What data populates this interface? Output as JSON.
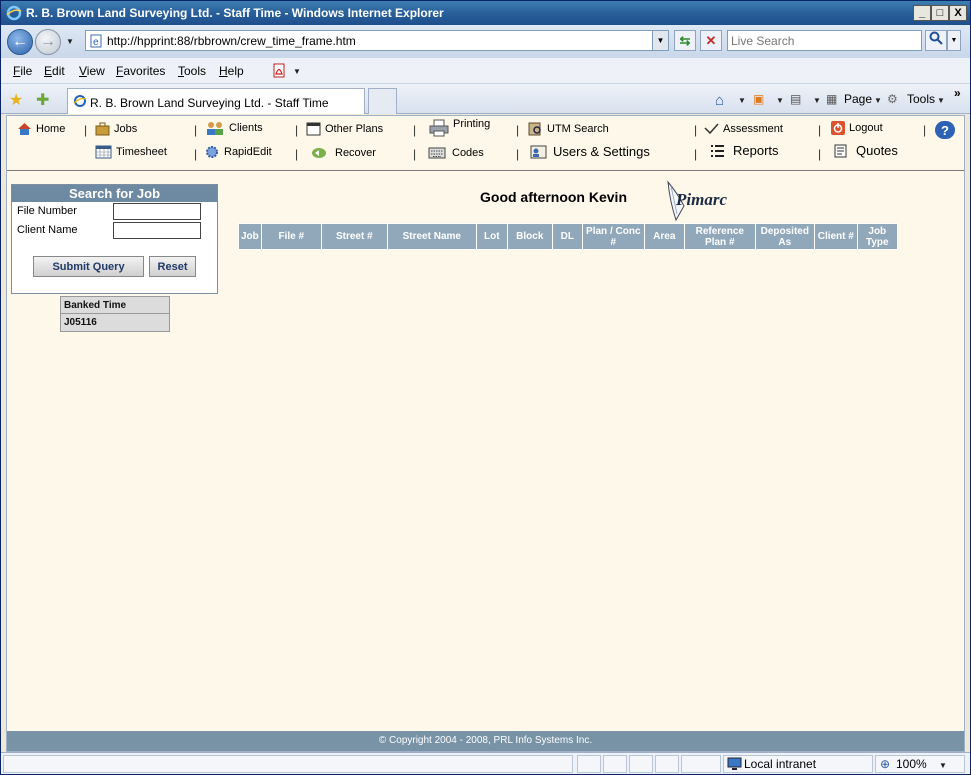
{
  "window": {
    "title": "R. B. Brown Land Surveying Ltd. - Staff Time - Windows Internet Explorer",
    "minimize": "_",
    "maximize": "□",
    "close": "X"
  },
  "address": {
    "url": "http://hpprint:88/rbbrown/crew_time_frame.htm",
    "search_placeholder": "Live Search"
  },
  "menu": [
    "File",
    "Edit",
    "View",
    "Favorites",
    "Tools",
    "Help"
  ],
  "tab": {
    "label": "R. B. Brown Land Surveying Ltd. - Staff Time"
  },
  "commandbar": {
    "page": "Page",
    "tools": "Tools",
    "more": "»"
  },
  "nav": {
    "home": "Home",
    "jobs": "Jobs",
    "clients": "Clients",
    "other_plans": "Other Plans",
    "printing": "Printing",
    "utm_search": "UTM Search",
    "assessment": "Assessment",
    "logout": "Logout",
    "help": "?",
    "timesheet": "Timesheet",
    "rapidedit": "RapidEdit",
    "recover": "Recover",
    "codes": "Codes",
    "users_settings": "Users & Settings",
    "reports": "Reports",
    "quotes": "Quotes",
    "separator": "|"
  },
  "search_panel": {
    "title": "Search for Job",
    "file_number_label": "File Number",
    "client_name_label": "Client Name",
    "submit": "Submit Query",
    "reset": "Reset"
  },
  "banked": {
    "header": "Banked Time",
    "value": "J05116"
  },
  "greeting": "Good afternoon Kevin",
  "logo_text": "Pimarc",
  "job_columns": [
    "Job",
    "File #",
    "Street #",
    "Street Name",
    "Lot",
    "Block",
    "DL",
    "Plan / Conc #",
    "Area",
    "Reference Plan #",
    "Deposited As",
    "Client #",
    "Job Type"
  ],
  "footer": "© Copyright 2004 - 2008, PRL Info Systems Inc.",
  "status": {
    "zone": "Local intranet",
    "zoom": "100%"
  }
}
